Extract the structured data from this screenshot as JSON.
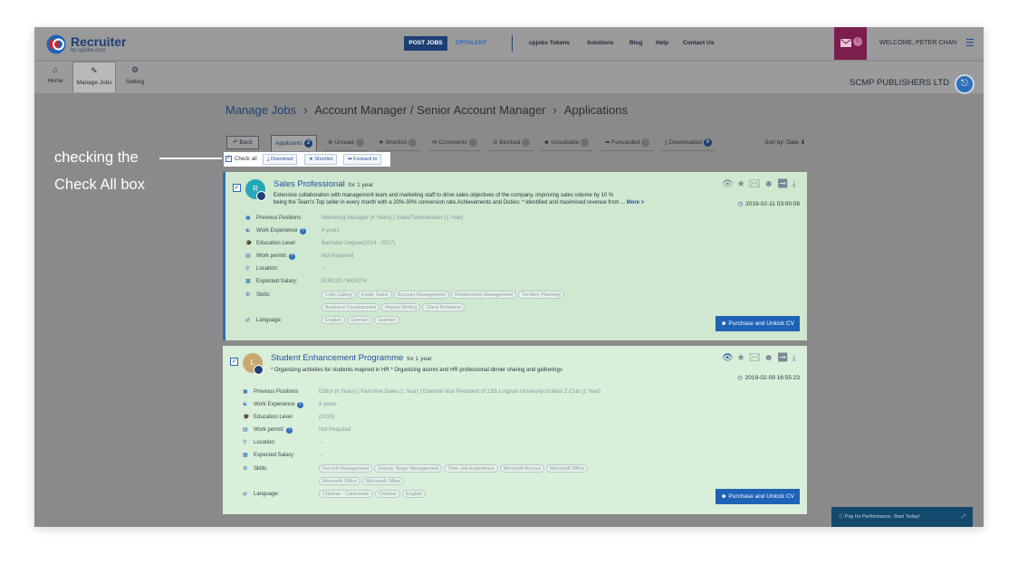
{
  "brand": {
    "name": "Recruiter",
    "sub": "by cpjobs.com",
    "accent": "#1d3f73",
    "logo_red": "#c8262f",
    "logo_blue": "#1e63b5"
  },
  "topnav": {
    "post_jobs": "POST JOBS",
    "cptalent": "CPTALENT",
    "links": [
      "cpjobs Tokens",
      "Solutions",
      "Blog",
      "Help",
      "Contact Us"
    ],
    "welcome": "WELCOME, PETER CHAN",
    "message_badge": "0",
    "menu_icon": "hamburger-icon"
  },
  "subnav": {
    "tabs": [
      {
        "label": "Home",
        "icon": "home-icon"
      },
      {
        "label": "Manage Jobs",
        "icon": "edit-icon"
      },
      {
        "label": "Setting",
        "icon": "gear-icon"
      }
    ],
    "company": "SCMP PUBLISHERS LTD"
  },
  "breadcrumb": {
    "first": "Manage Jobs",
    "second": "Account Manager / Senior Account Manager",
    "third": "Applications"
  },
  "filters": {
    "back": "Back",
    "tabs": [
      {
        "label": "Applicants",
        "count": "2"
      },
      {
        "label": "Unread",
        "count": ""
      },
      {
        "label": "Shortlist",
        "count": ""
      },
      {
        "label": "Comments",
        "count": ""
      },
      {
        "label": "Blocked",
        "count": ""
      },
      {
        "label": "Unsuitable",
        "count": ""
      },
      {
        "label": "Forwarded",
        "count": ""
      },
      {
        "label": "Downloaded",
        "count": "0"
      }
    ],
    "sort": "Sort by: Date"
  },
  "bulk": {
    "check_all": "Check all",
    "download": "Download",
    "shortlist": "Shortlist",
    "forward": "Forward to"
  },
  "annotation": {
    "line1": "checking the",
    "line2": "Check All box"
  },
  "labels": {
    "previous_positions": "Previous Positions",
    "work_experience": "Work Experience",
    "education_level": "Education Level",
    "work_permit": "Work permit:",
    "location": "Location:",
    "expected_salary": "Expected Salary:",
    "skills": "Skills:",
    "language": "Language:",
    "unlock": "Purchase and Unlock CV",
    "more": "More >",
    "help": "?"
  },
  "applicants": [
    {
      "initial": "R",
      "avatar_color": "#27a6b9",
      "title": "Sales Professional",
      "duration": "for 1 year",
      "desc_line1": "Extensive collaboration with management team and marketing staff to drive sales objectives of the company, improving sales volume by 10 %",
      "desc_line2": "being the Team's Top seller in every month with a 20%-30% conversion rate.Achievements and Duties: * Identified and maximised revenue from ...",
      "timestamp": "2019-02-11 03:00:08",
      "previous_positions": "Marketing Manager (4 Years)  |  Sales/Telemarketer (1 Year)",
      "work_experience": "4 years",
      "education_level": "Bachelor Degree(2014 - 2017)",
      "work_permit": "Not Required",
      "location": "--",
      "expected_salary": "EUR100 / MONTH",
      "skills": [
        "Cold Calling",
        "Inside Sales",
        "Account Management",
        "Relationship Management",
        "Territory Planning",
        "Business Development",
        "Report Writing",
        "Client Relations"
      ],
      "languages": [
        "English",
        "German",
        "Spanish"
      ]
    },
    {
      "initial": "L",
      "avatar_color": "#c9a871",
      "title": "Student Enhancement Programme",
      "duration": "for 1 year",
      "desc_line1": "* Organizing activities for students majored in HR * Organizing alumni and HR professional dinner sharing and gatherings",
      "desc_line2": "",
      "timestamp": "2019-02-09 16:55:23",
      "previous_positions": "Editor (6 Years)  |  Part-time Sales (1 Year)  |  External Vice President of 13th Lingnan University Golden Z Club (1 Year)",
      "work_experience": "8 years",
      "education_level": "(2019)",
      "work_permit": "Not Required",
      "location": "--",
      "expected_salary": "--",
      "skills": [
        "Record Management",
        "Deputy Stage Management",
        "Time Job Experience",
        "Microsoft Access",
        "Microsoft Office",
        "Microsoft Office",
        "Microsoft Office"
      ],
      "languages": [
        "Chinese - Cantonese",
        "Chinese",
        "English"
      ]
    }
  ],
  "pay_bar": {
    "text": "Pay for Performance. Start Today!",
    "icon": "expand-icon"
  }
}
